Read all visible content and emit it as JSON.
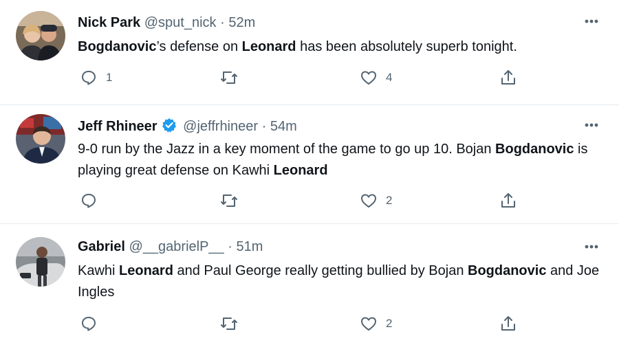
{
  "colors": {
    "text": "#0f1419",
    "muted": "#536471",
    "divider": "#e6ecf0",
    "verified": "#1d9bf0"
  },
  "tweets": [
    {
      "name": "Nick Park",
      "handle": "@sput_nick",
      "sep": "·",
      "time": "52m",
      "verified": false,
      "body": [
        {
          "b": "Bogdanovic"
        },
        {
          "t": "’s defense on "
        },
        {
          "b": "Leonard"
        },
        {
          "t": " has been absolutely superb tonight."
        }
      ],
      "reply_count": "1",
      "like_count": "4"
    },
    {
      "name": "Jeff Rhineer",
      "handle": "@jeffrhineer",
      "sep": "·",
      "time": "54m",
      "verified": true,
      "body": [
        {
          "t": "9-0 run by the Jazz in a key moment of the game to go up 10. Bojan "
        },
        {
          "b": "Bogdanovic"
        },
        {
          "t": " is playing great defense on Kawhi "
        },
        {
          "b": "Leonard"
        }
      ],
      "reply_count": "",
      "like_count": "2"
    },
    {
      "name": "Gabriel",
      "handle": "@__gabrielP__",
      "sep": "·",
      "time": "51m",
      "verified": false,
      "body": [
        {
          "t": "Kawhi "
        },
        {
          "b": "Leonard"
        },
        {
          "t": " and Paul George really getting bullied by Bojan "
        },
        {
          "b": "Bogdanovic"
        },
        {
          "t": " and Joe Ingles"
        }
      ],
      "reply_count": "",
      "like_count": "2"
    }
  ]
}
